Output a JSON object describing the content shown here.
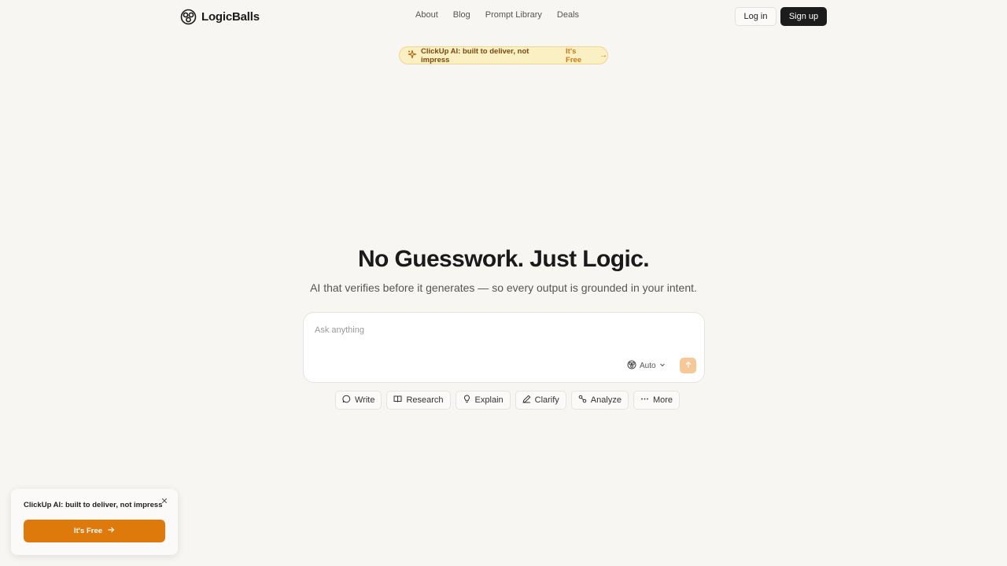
{
  "header": {
    "logo_text": "LogicBalls",
    "nav": [
      "About",
      "Blog",
      "Prompt Library",
      "Deals"
    ],
    "login_label": "Log in",
    "signup_label": "Sign up"
  },
  "promo": {
    "text": "ClickUp AI: built to deliver, not impress",
    "cta": "It's Free"
  },
  "hero": {
    "title": "No Guesswork. Just Logic.",
    "subtitle": "AI that verifies before it generates — so every output is grounded in your intent."
  },
  "ask": {
    "placeholder": "Ask anything",
    "model": "Auto"
  },
  "chips": [
    "Write",
    "Research",
    "Explain",
    "Clarify",
    "Analyze",
    "More"
  ],
  "toast": {
    "text": "ClickUp AI: built to deliver, not impress",
    "cta": "It's Free"
  },
  "colors": {
    "background": "#f7f6f3",
    "accent": "#de7a0c",
    "promo_bg": "#fbefc4",
    "send_button": "#f6c895",
    "dark_button": "#1c1c1c"
  },
  "icons": {
    "logo": "logicballs-logo-icon",
    "promo": "sparkles-icon",
    "send": "arrow-up-icon",
    "chips": [
      "chat-bubble-icon",
      "book-icon",
      "lightbulb-icon",
      "pencil-icon",
      "analyze-icon",
      "ellipsis-icon"
    ]
  }
}
